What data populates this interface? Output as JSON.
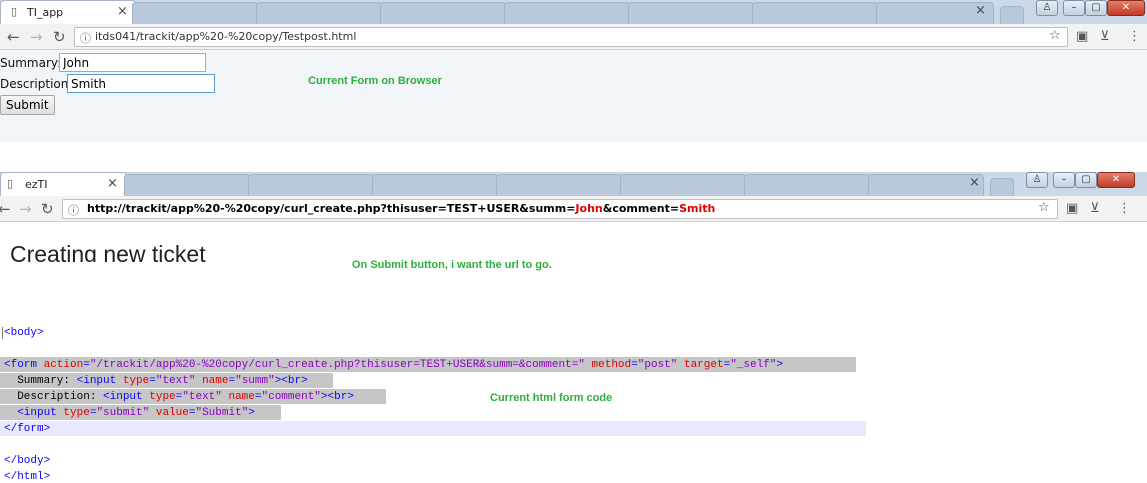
{
  "window1": {
    "active_tab": {
      "title": "TI_app",
      "close": "×"
    },
    "background_tab_count": 7,
    "url": "itds041/trackit/app%20-%20copy/Testpost.html",
    "form": {
      "summary_label": "Summary:",
      "summary_value": "John",
      "description_label": "Description:",
      "description_value": "Smith",
      "submit_label": "Submit"
    },
    "annotation": "Current Form on Browser"
  },
  "window2": {
    "active_tab": {
      "title": "ezTI",
      "close": "×"
    },
    "url_parts": [
      {
        "text": "http://trackit/app%20-%20copy/curl_create.php?thisuser=TEST+USER&summ=",
        "color": "#000000"
      },
      {
        "text": "John",
        "color": "#e00000"
      },
      {
        "text": "&comment=",
        "color": "#000000"
      },
      {
        "text": "Smith",
        "color": "#e00000"
      }
    ],
    "heading": "Creating new ticket",
    "annotation": "On Submit button, i want the url to go."
  },
  "code_annotation": "Current html form code",
  "code_lines": [
    [
      {
        "t": "<body>",
        "c": "tag"
      }
    ],
    [],
    [
      {
        "t": "<form ",
        "c": "tag"
      },
      {
        "t": "action",
        "c": "attr"
      },
      {
        "t": "=",
        "c": "tag"
      },
      {
        "t": "\"/trackit/app%20-%20copy/curl_create.php?thisuser=TEST+USER&summ=&comment=\"",
        "c": "val"
      },
      {
        "t": " "
      },
      {
        "t": "method",
        "c": "attr"
      },
      {
        "t": "=",
        "c": "tag"
      },
      {
        "t": "\"post\"",
        "c": "val"
      },
      {
        "t": " "
      },
      {
        "t": "target",
        "c": "attr"
      },
      {
        "t": "=",
        "c": "tag"
      },
      {
        "t": "\"_self\"",
        "c": "val"
      },
      {
        "t": ">",
        "c": "tag"
      }
    ],
    [
      {
        "t": "  Summary: ",
        "c": "text"
      },
      {
        "t": "<input ",
        "c": "tag"
      },
      {
        "t": "type",
        "c": "attr"
      },
      {
        "t": "=",
        "c": "tag"
      },
      {
        "t": "\"text\"",
        "c": "val"
      },
      {
        "t": " "
      },
      {
        "t": "name",
        "c": "attr"
      },
      {
        "t": "=",
        "c": "tag"
      },
      {
        "t": "\"summ\"",
        "c": "val"
      },
      {
        "t": "><br>",
        "c": "tag"
      }
    ],
    [
      {
        "t": "  Description: ",
        "c": "text"
      },
      {
        "t": "<input ",
        "c": "tag"
      },
      {
        "t": "type",
        "c": "attr"
      },
      {
        "t": "=",
        "c": "tag"
      },
      {
        "t": "\"text\"",
        "c": "val"
      },
      {
        "t": " "
      },
      {
        "t": "name",
        "c": "attr"
      },
      {
        "t": "=",
        "c": "tag"
      },
      {
        "t": "\"comment\"",
        "c": "val"
      },
      {
        "t": "><br>",
        "c": "tag"
      }
    ],
    [
      {
        "t": "  ",
        "c": "text"
      },
      {
        "t": "<input ",
        "c": "tag"
      },
      {
        "t": "type",
        "c": "attr"
      },
      {
        "t": "=",
        "c": "tag"
      },
      {
        "t": "\"submit\"",
        "c": "val"
      },
      {
        "t": " "
      },
      {
        "t": "value",
        "c": "attr"
      },
      {
        "t": "=",
        "c": "tag"
      },
      {
        "t": "\"Submit\"",
        "c": "val"
      },
      {
        "t": ">",
        "c": "tag"
      }
    ],
    [
      {
        "t": "</form>",
        "c": "tag"
      }
    ],
    [],
    [
      {
        "t": "</body>",
        "c": "tag"
      }
    ],
    [
      {
        "t": "</html>",
        "c": "tag"
      }
    ]
  ],
  "icons": {
    "back": "back-arrow-icon",
    "forward": "forward-arrow-icon",
    "reload": "reload-icon",
    "info": "info-icon",
    "star": "bookmark-star-icon",
    "menu": "menu-dots-icon"
  }
}
